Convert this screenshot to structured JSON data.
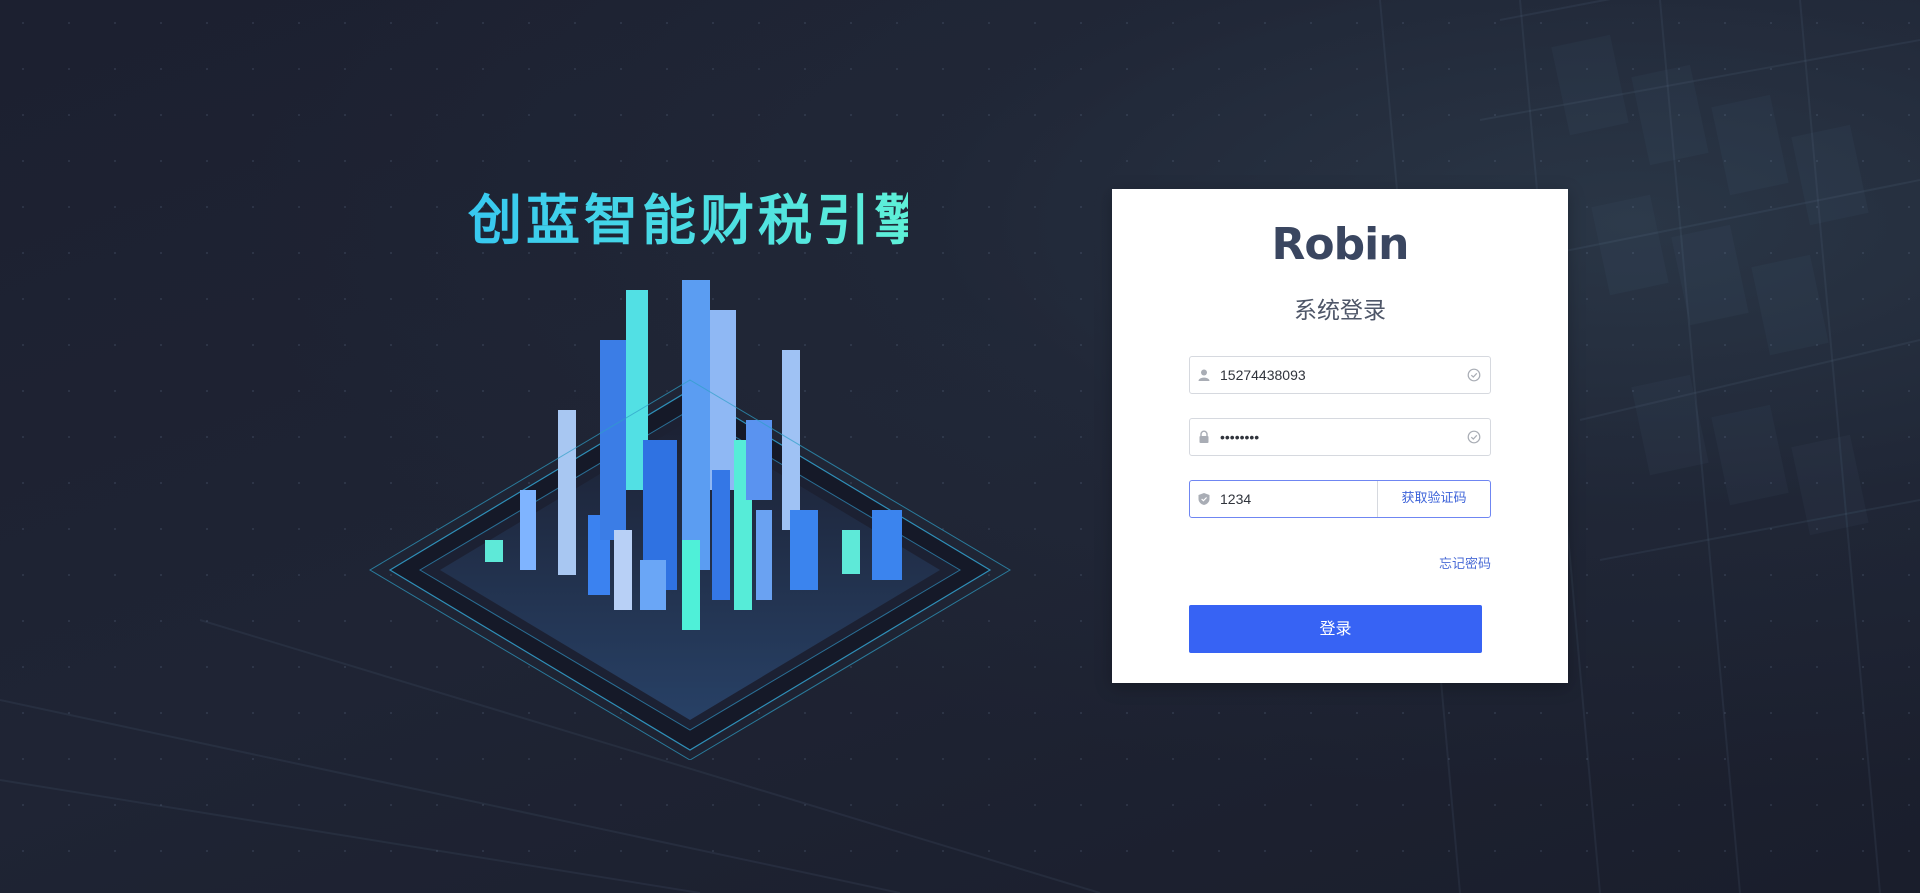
{
  "hero": {
    "title": "创蓝智能财税引擎"
  },
  "login": {
    "logo": "Robin",
    "title": "系统登录",
    "username": {
      "value": "15274438093",
      "prefix_icon": "user-icon",
      "suffix_icon": "check-circle-icon"
    },
    "password": {
      "value": "••••••••",
      "prefix_icon": "lock-icon",
      "suffix_icon": "check-circle-icon"
    },
    "code": {
      "value": "1234",
      "prefix_icon": "shield-icon",
      "button_label": "获取验证码"
    },
    "forgot_label": "忘记密码",
    "submit_label": "登录"
  },
  "colors": {
    "accent": "#3763f4",
    "link": "#4a6bd6",
    "title_cyan": "#3fd8e6",
    "background": "#1f2434"
  }
}
